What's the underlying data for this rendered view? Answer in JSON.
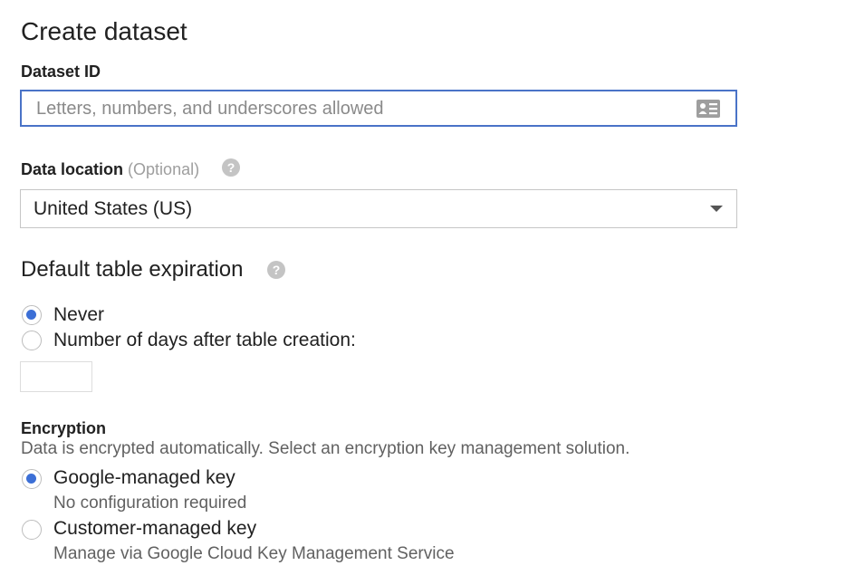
{
  "title": "Create dataset",
  "dataset_id": {
    "label": "Dataset ID",
    "placeholder": "Letters, numbers, and underscores allowed",
    "value": ""
  },
  "data_location": {
    "label": "Data location",
    "optional": "(Optional)",
    "selected": "United States (US)"
  },
  "expiration": {
    "heading": "Default table expiration",
    "options": [
      {
        "label": "Never",
        "checked": true
      },
      {
        "label": "Number of days after table creation:",
        "checked": false
      }
    ],
    "days_value": ""
  },
  "encryption": {
    "heading": "Encryption",
    "description": "Data is encrypted automatically. Select an encryption key management solution.",
    "options": [
      {
        "label": "Google-managed key",
        "sub": "No configuration required",
        "checked": true
      },
      {
        "label": "Customer-managed key",
        "sub": "Manage via Google Cloud Key Management Service",
        "checked": false
      }
    ]
  },
  "icons": {
    "help": "help-circle-icon",
    "id_card": "contact-card-icon",
    "dropdown": "caret-down-icon"
  },
  "colors": {
    "accent": "#3c6fd6",
    "focus_border": "#4a73c7",
    "help_icon": "#c4c4c4",
    "muted_text": "#616161"
  }
}
